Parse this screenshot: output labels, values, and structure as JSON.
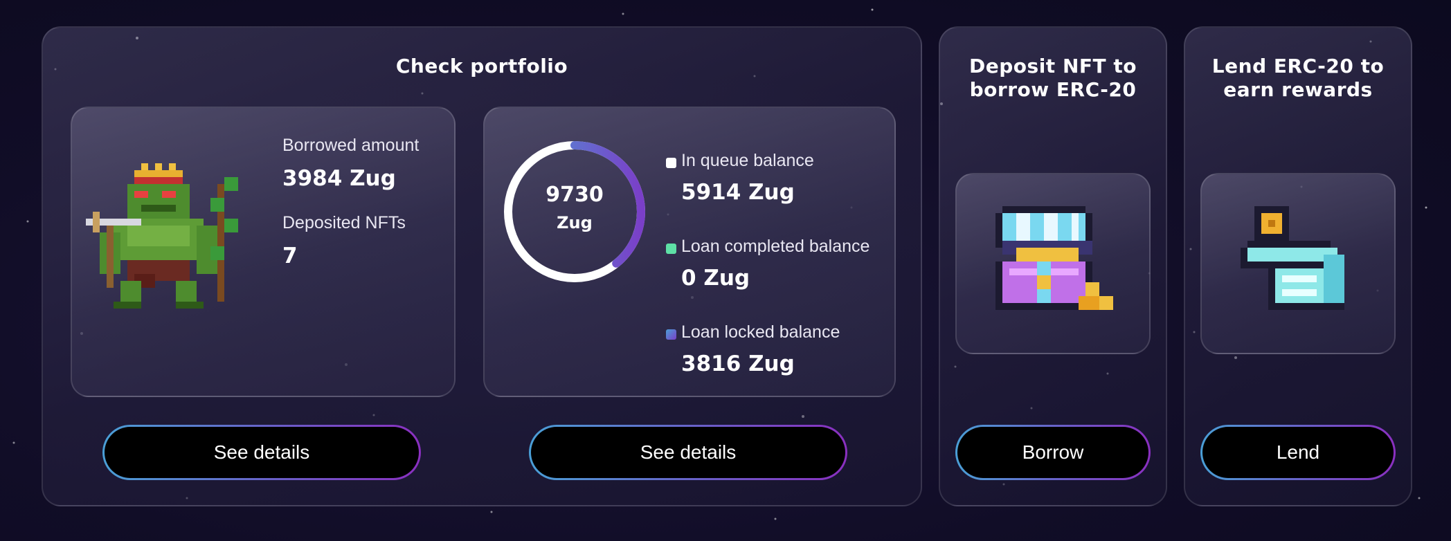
{
  "portfolio": {
    "title": "Check portfolio",
    "nft_card": {
      "image": "green-ogre-crossbow-icon",
      "borrowed_label": "Borrowed amount",
      "borrowed_value": "3984 Zug",
      "deposited_label": "Deposited NFTs",
      "deposited_value": "7",
      "button_label": "See details"
    },
    "balance_card": {
      "ring_total": "9730",
      "ring_unit": "Zug",
      "ring_fraction_filled": 0.392,
      "items": [
        {
          "label": "In queue balance",
          "value": "5914 Zug",
          "color": "#ffffff"
        },
        {
          "label": "Loan completed balance",
          "value": "0 Zug",
          "color": "#5ee0a6"
        },
        {
          "label": "Loan locked balance",
          "value": "3816 Zug",
          "color": "#6a5ec8"
        }
      ],
      "button_label": "See details"
    }
  },
  "deposit": {
    "title_line1": "Deposit NFT to",
    "title_line2": "borrow ERC-20",
    "image": "treasure-chest-icon",
    "button_label": "Borrow"
  },
  "lend": {
    "title_line1": "Lend ERC-20 to",
    "title_line2": "earn rewards",
    "image": "hand-holding-coin-icon",
    "button_label": "Lend"
  },
  "colors": {
    "button_gradient_start": "#4a9fd6",
    "button_gradient_end": "#8a2fc0",
    "ring_arc_start": "#4a9fd6",
    "ring_arc_end": "#7a3fc8"
  }
}
